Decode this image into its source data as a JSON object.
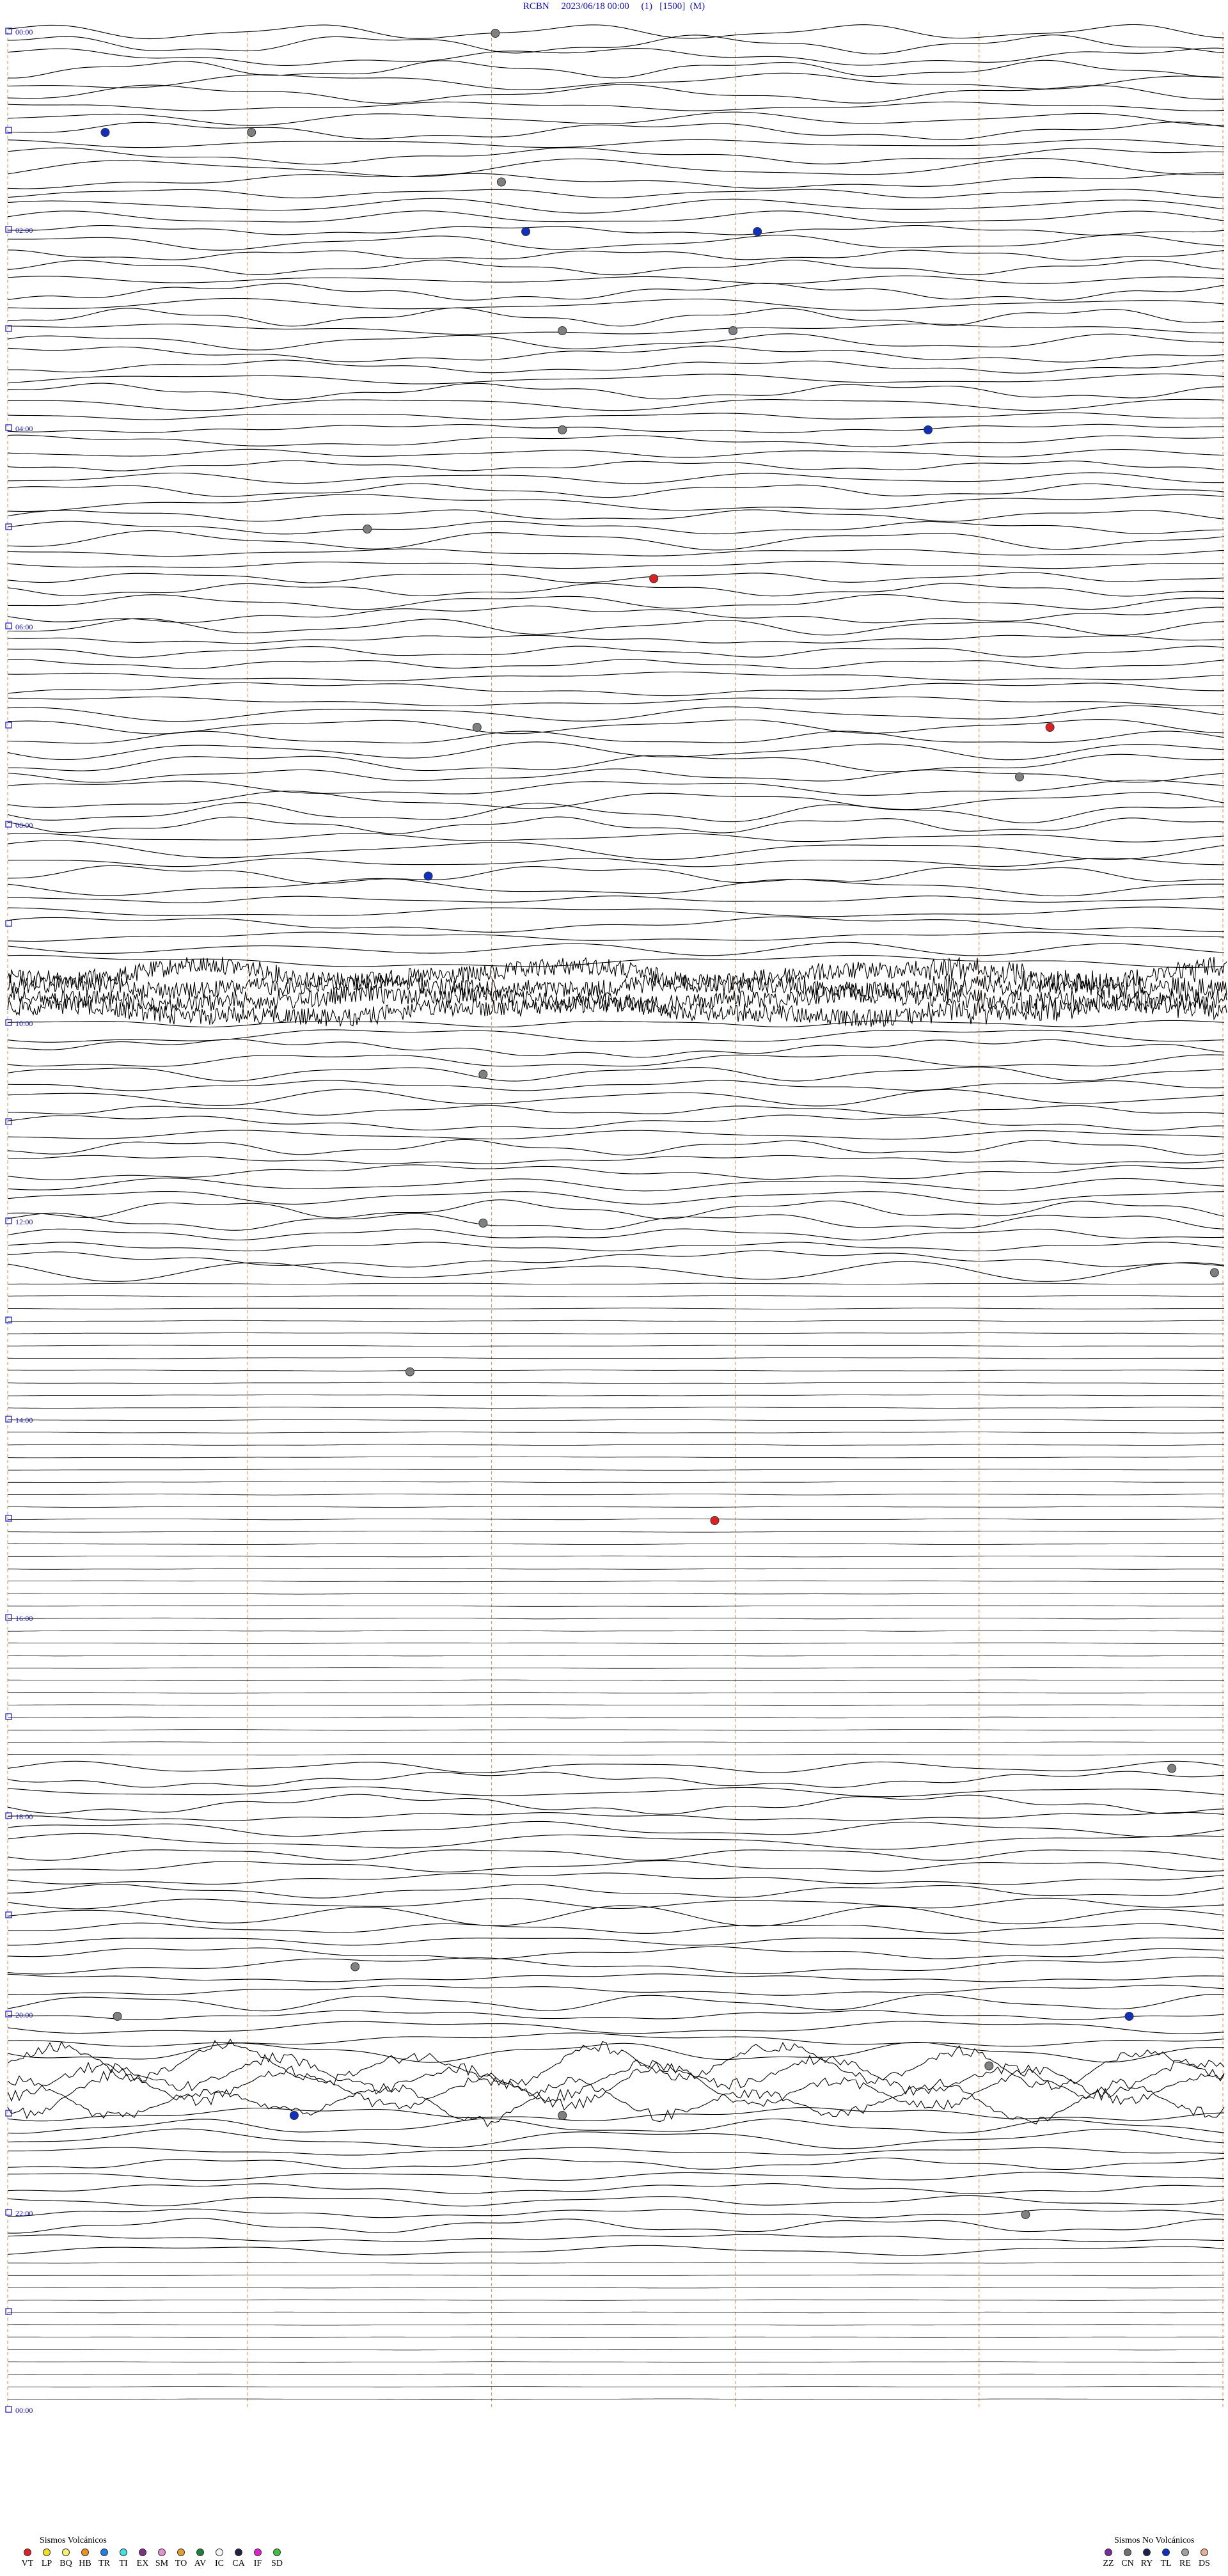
{
  "header": {
    "station": "RCBN",
    "datetime": "2023/06/18 00:00",
    "channel": "(1)",
    "scale": "[1500]",
    "mode": "(M)"
  },
  "chart_data": {
    "type": "helicorder",
    "time_labels": [
      "00:00",
      "02:00",
      "04:00",
      "06:00",
      "08:00",
      "10:00",
      "12:00",
      "14:00",
      "16:00",
      "18:00",
      "20:00",
      "22:00",
      "00:00"
    ],
    "time_label_hours": [
      0,
      2,
      4,
      6,
      8,
      10,
      12,
      14,
      16,
      18,
      20,
      22,
      24
    ],
    "minute_divisions": 5,
    "grid": true,
    "colors": {
      "trace": "#000000",
      "time_label": "#1010c0",
      "minute_grid": "#e07020"
    },
    "events": [
      {
        "hour": 0.0,
        "minute": 40.0,
        "class": "gray"
      },
      {
        "hour": 1.0,
        "minute": 8.0,
        "class": "blue"
      },
      {
        "hour": 1.0,
        "minute": 20.0,
        "class": "gray"
      },
      {
        "hour": 1.5,
        "minute": 40.5,
        "class": "gray"
      },
      {
        "hour": 2.0,
        "minute": 42.5,
        "class": "blue"
      },
      {
        "hour": 2.0,
        "minute": 61.5,
        "class": "blue"
      },
      {
        "hour": 3.0,
        "minute": 45.5,
        "class": "gray"
      },
      {
        "hour": 3.0,
        "minute": 59.5,
        "class": "gray"
      },
      {
        "hour": 4.0,
        "minute": 45.5,
        "class": "gray"
      },
      {
        "hour": 4.0,
        "minute": 75.5,
        "class": "blue"
      },
      {
        "hour": 5.0,
        "minute": 29.5,
        "class": "gray"
      },
      {
        "hour": 5.5,
        "minute": 53.0,
        "class": "red"
      },
      {
        "hour": 7.0,
        "minute": 38.5,
        "class": "gray"
      },
      {
        "hour": 7.0,
        "minute": 85.5,
        "class": "red"
      },
      {
        "hour": 7.5,
        "minute": 83.0,
        "class": "gray"
      },
      {
        "hour": 8.5,
        "minute": 34.5,
        "class": "blue"
      },
      {
        "hour": 10.5,
        "minute": 39.0,
        "class": "gray"
      },
      {
        "hour": 12.0,
        "minute": 39.0,
        "class": "gray"
      },
      {
        "hour": 12.5,
        "minute": 99.0,
        "class": "gray"
      },
      {
        "hour": 13.5,
        "minute": 33.0,
        "class": "gray"
      },
      {
        "hour": 15.0,
        "minute": 58.0,
        "class": "red"
      },
      {
        "hour": 17.5,
        "minute": 95.5,
        "class": "gray"
      },
      {
        "hour": 19.5,
        "minute": 28.5,
        "class": "gray"
      },
      {
        "hour": 20.0,
        "minute": 9.0,
        "class": "gray"
      },
      {
        "hour": 20.0,
        "minute": 92.0,
        "class": "blue"
      },
      {
        "hour": 20.5,
        "minute": 80.5,
        "class": "gray"
      },
      {
        "hour": 21.0,
        "minute": 23.5,
        "class": "blue"
      },
      {
        "hour": 21.0,
        "minute": 45.5,
        "class": "gray"
      },
      {
        "hour": 22.0,
        "minute": 83.5,
        "class": "gray"
      }
    ]
  },
  "legend": {
    "volcanic": {
      "title": "Sismos Volcánicos",
      "items": [
        {
          "code": "VT",
          "color": "#e02020"
        },
        {
          "code": "LP",
          "color": "#f0e020"
        },
        {
          "code": "BQ",
          "color": "#f8f070"
        },
        {
          "code": "HB",
          "color": "#f09020"
        },
        {
          "code": "TR",
          "color": "#2080e0"
        },
        {
          "code": "TI",
          "color": "#40e0e0"
        },
        {
          "code": "EX",
          "color": "#803080"
        },
        {
          "code": "SM",
          "color": "#e090d0"
        },
        {
          "code": "TO",
          "color": "#e0a030"
        },
        {
          "code": "AV",
          "color": "#208040"
        },
        {
          "code": "IC",
          "color": "#f4f4f4"
        },
        {
          "code": "CA",
          "color": "#202040"
        },
        {
          "code": "IF",
          "color": "#e020d0"
        },
        {
          "code": "SD",
          "color": "#40c040"
        }
      ]
    },
    "non_volcanic": {
      "title": "Sismos No Volcánicos",
      "items": [
        {
          "code": "ZZ",
          "color": "#7a2a9a"
        },
        {
          "code": "CN",
          "color": "#707070"
        },
        {
          "code": "RY",
          "color": "#202050"
        },
        {
          "code": "TL",
          "color": "#1030c0"
        },
        {
          "code": "RE",
          "color": "#a0a0a0"
        },
        {
          "code": "DS",
          "color": "#e0b090"
        }
      ]
    }
  }
}
